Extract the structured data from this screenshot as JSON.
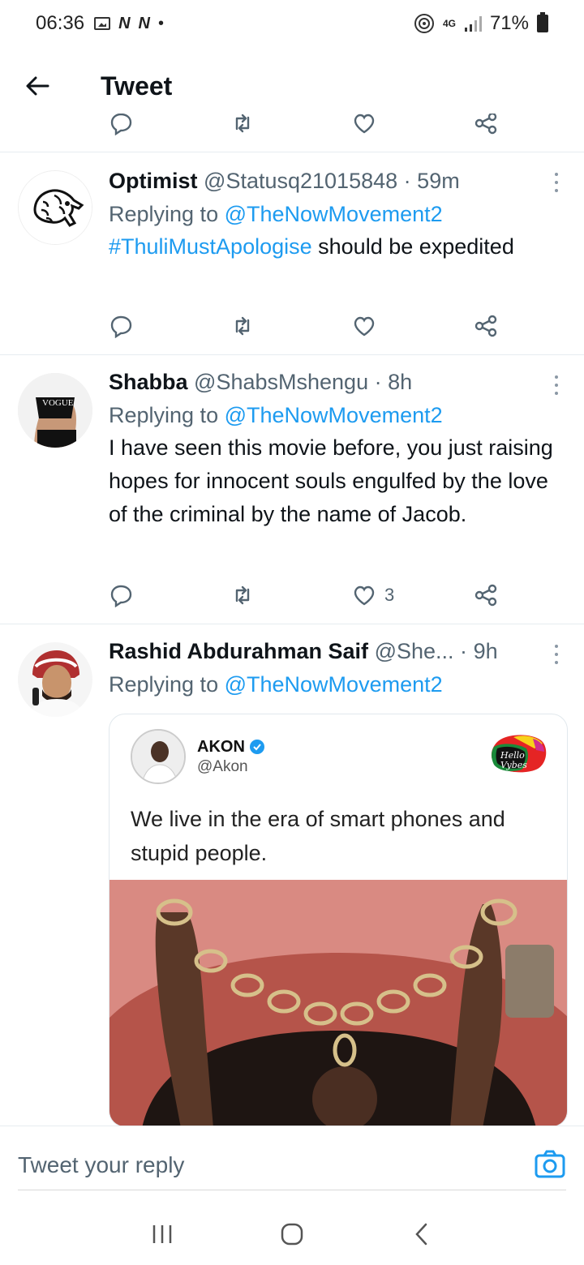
{
  "status_bar": {
    "time": "06:36",
    "carrier_icons": [
      "N",
      "N"
    ],
    "battery": "71%",
    "network": "4G"
  },
  "header": {
    "title": "Tweet"
  },
  "tweets": [
    {
      "name": "Optimist",
      "handle": "@Statusq21015848",
      "time": "59m",
      "replying_prefix": "Replying to",
      "replying_to": "@TheNowMovement2",
      "hashtag": "#ThuliMustApologise",
      "text_after_hashtag": " should be expedited",
      "likes": ""
    },
    {
      "name": "Shabba",
      "handle": "@ShabsMshengu",
      "time": "8h",
      "replying_prefix": "Replying to",
      "replying_to": "@TheNowMovement2",
      "text": "I have seen this movie before, you just raising hopes for innocent souls engulfed by the love of the criminal by the name of Jacob.",
      "likes": "3"
    },
    {
      "name": "Rashid Abdurahman Saif",
      "handle": "@She...",
      "time": "9h",
      "replying_prefix": "Replying to",
      "replying_to": "@TheNowMovement2",
      "quote": {
        "name": "AKON",
        "handle": "@Akon",
        "text": "We live in the era of smart phones and stupid people.",
        "logo_text_1": "Hello",
        "logo_text_2": "Vybes"
      }
    }
  ],
  "reply_bar": {
    "placeholder": "Tweet your reply"
  },
  "colors": {
    "link": "#1d9bf0",
    "secondary": "#536471",
    "border": "#e6ecf0"
  }
}
